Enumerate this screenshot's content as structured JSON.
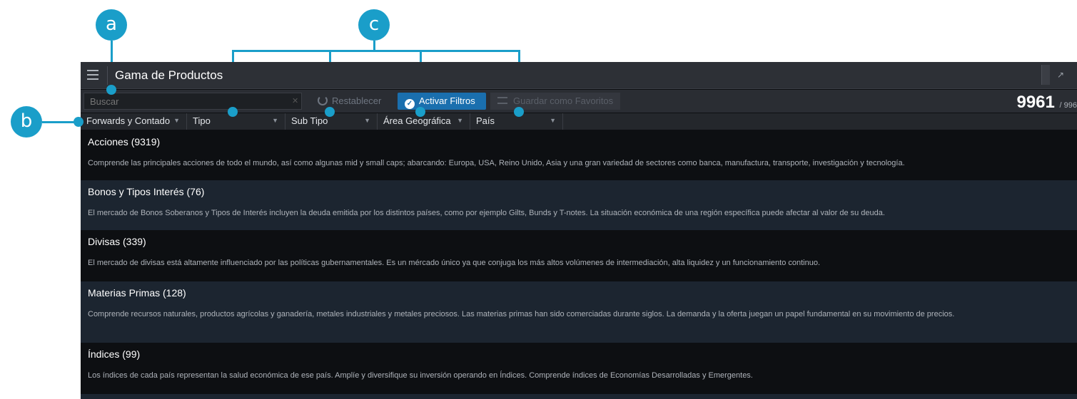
{
  "callouts": [
    "a",
    "b",
    "c"
  ],
  "window": {
    "title": "Gama de Productos"
  },
  "toolbar": {
    "search_placeholder": "Buscar",
    "reset_label": "Restablecer",
    "filters_label": "Activar Filtros",
    "favorites_label": "Guardar como Favoritos",
    "count": "9961",
    "count_total": "/ 996"
  },
  "filters": [
    {
      "label": "Forwards y Contado"
    },
    {
      "label": "Tipo"
    },
    {
      "label": "Sub Tipo"
    },
    {
      "label": "Área Geográfica"
    },
    {
      "label": "País"
    }
  ],
  "categories": [
    {
      "title": "Acciones (9319)",
      "description": "Comprende las principales acciones de todo el mundo, así como algunas mid y small caps; abarcando: Europa, USA, Reino Unido, Asia y una gran variedad de sectores como banca, manufactura, transporte, investigación y tecnología."
    },
    {
      "title": "Bonos y Tipos Interés (76)",
      "description": "El mercado de Bonos Soberanos y Tipos de Interés incluyen la deuda emitida por los distintos países, como por ejemplo Gilts, Bunds y T-notes. La situación económica de una región específica puede afectar al valor de su deuda."
    },
    {
      "title": "Divisas (339)",
      "description": "El mercado de divisas está altamente influenciado por las políticas gubernamentales. Es un mércado único ya que conjuga los más altos volúmenes de intermediación, alta liquidez y un funcionamiento continuo."
    },
    {
      "title": "Materias Primas (128)",
      "description": "Comprende recursos naturales, productos agrícolas y ganadería, metales industriales y metales preciosos. Las materias primas han sido comerciadas durante siglos. La demanda y la oferta juegan un papel fundamental en su movimiento de precios."
    },
    {
      "title": "Índices (99)",
      "description": "Los índices de cada país representan la salud económica de ese país. Amplíe y diversifique su inversión operando en Índices. Comprende índices de Economías Desarrolladas y Emergentes."
    }
  ],
  "colors": {
    "accent": "#1a9ec9",
    "button_active": "#1a6fae",
    "row_dark": "#0d0f12",
    "row_light": "#1c2530"
  }
}
